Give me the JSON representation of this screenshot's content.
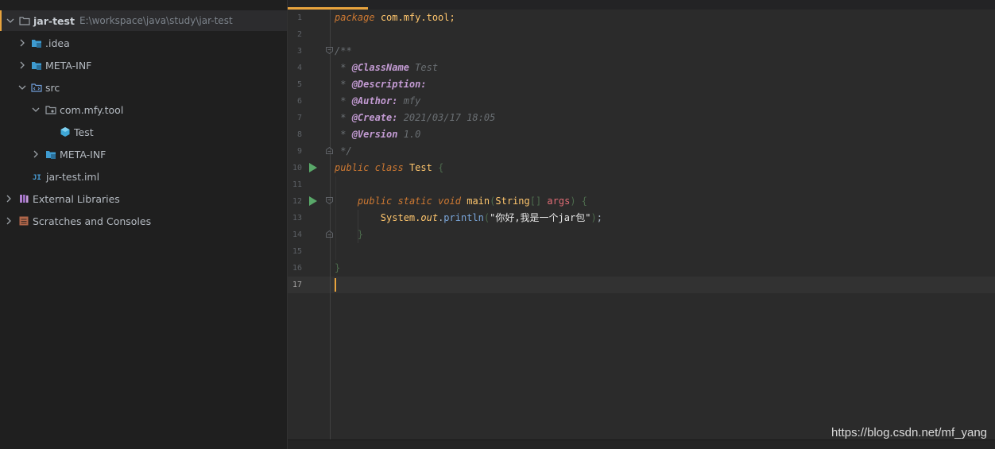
{
  "project_tree": {
    "root": {
      "name": "jar-test",
      "path": "E:\\workspace\\java\\study\\jar-test"
    },
    "items": [
      {
        "label": ".idea",
        "icon": "folder-icon"
      },
      {
        "label": "META-INF",
        "icon": "folder-icon"
      },
      {
        "label": "src",
        "icon": "source-folder-icon"
      },
      {
        "label": "com.mfy.tool",
        "icon": "package-icon"
      },
      {
        "label": "Test",
        "icon": "java-class-icon"
      },
      {
        "label": "META-INF",
        "icon": "folder-icon"
      },
      {
        "label": "jar-test.iml",
        "icon": "iml-file-icon"
      },
      {
        "label": "External Libraries",
        "icon": "libraries-icon"
      },
      {
        "label": "Scratches and Consoles",
        "icon": "scratches-icon"
      }
    ]
  },
  "editor": {
    "line_numbers": [
      "1",
      "2",
      "3",
      "4",
      "5",
      "6",
      "7",
      "8",
      "9",
      "10",
      "11",
      "12",
      "13",
      "14",
      "15",
      "16",
      "17"
    ],
    "code": {
      "l1_kw": "package",
      "l1_pkg": "com.mfy.tool;",
      "l3": "/**",
      "l4_star": " * ",
      "l4_tag": "@ClassName",
      "l4_val": " Test",
      "l5_star": " * ",
      "l5_tag": "@Description:",
      "l6_star": " * ",
      "l6_tag": "@Author:",
      "l6_val": " mfy",
      "l7_star": " * ",
      "l7_tag": "@Create:",
      "l7_val": " 2021/03/17 18:05",
      "l8_star": " * ",
      "l8_tag": "@Version",
      "l8_val": " 1.0",
      "l9": " */",
      "l10_kw1": "public",
      "l10_kw2": "class",
      "l10_cls": "Test",
      "l10_brace": "{",
      "l12_kw1": "public",
      "l12_kw2": "static",
      "l12_kw3": "void",
      "l12_name": "main",
      "l12_paren_open": "(",
      "l12_type": "String",
      "l12_arr": "[]",
      "l12_param": "args",
      "l12_paren_close": ")",
      "l12_brace": "{",
      "l13_sys": "System.",
      "l13_out": "out",
      "l13_dot": ".",
      "l13_method": "println",
      "l13_paren_open": "(",
      "l13_str": "\"你好,我是一个jar包\"",
      "l13_paren_close": ")",
      "l13_semi": ";",
      "l14_brace": "}",
      "l16_brace": "}"
    }
  },
  "watermark": "https://blog.csdn.net/mf_yang",
  "colors": {
    "accent": "#e8a33d",
    "keyword": "#cc7832",
    "doc_tag": "#c39bd3",
    "string": "#6a8759",
    "method_decl": "#ffc66d",
    "run_icon": "#59a869"
  }
}
